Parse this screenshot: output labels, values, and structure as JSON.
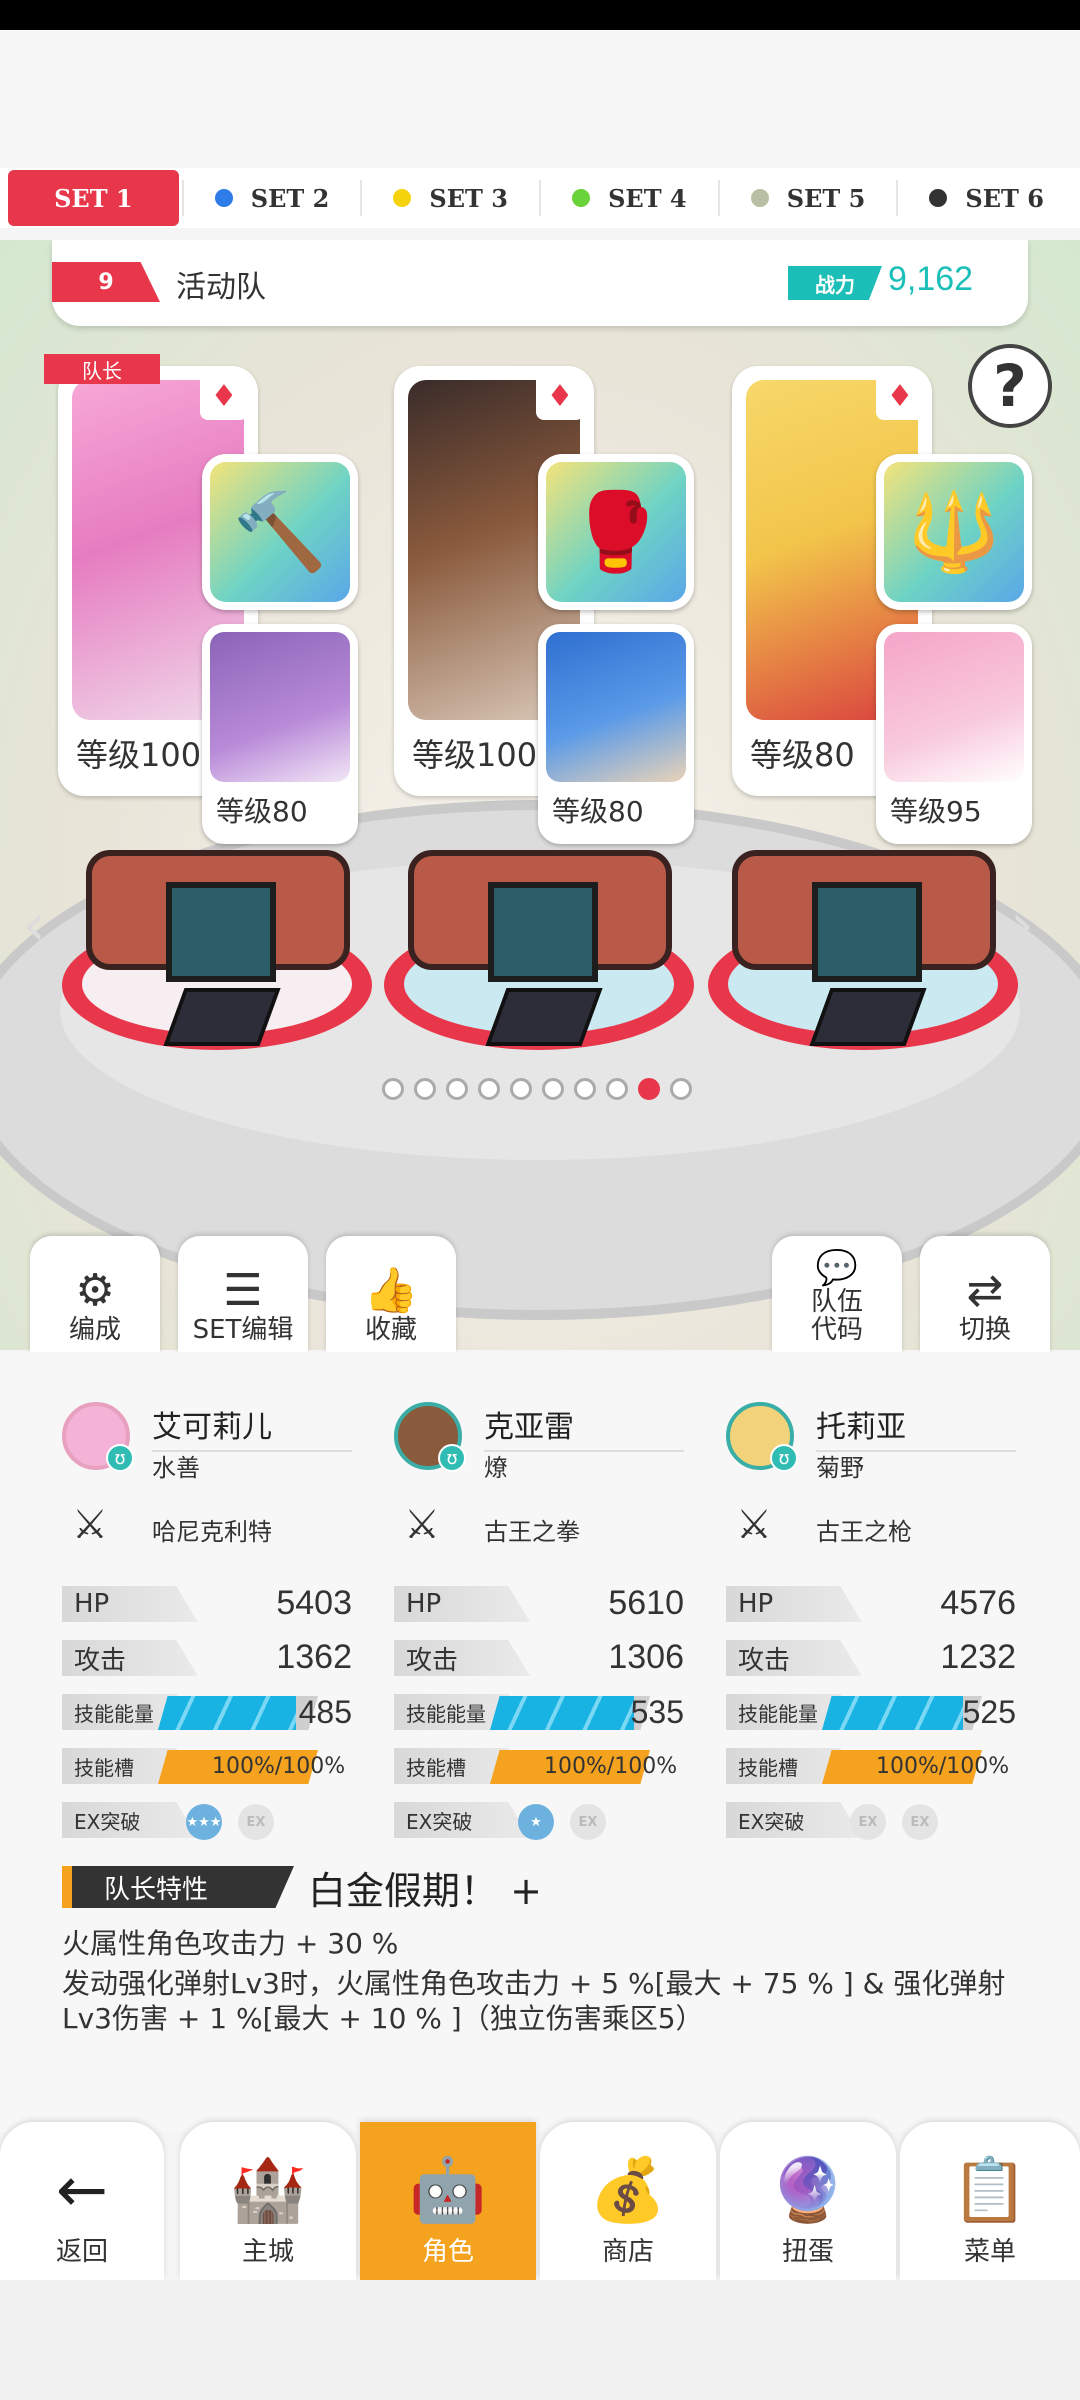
{
  "sets": [
    {
      "label": "SET 1",
      "color": "#e8374a",
      "active": true
    },
    {
      "label": "SET 2",
      "color": "#2f7be8"
    },
    {
      "label": "SET 3",
      "color": "#f5d30c"
    },
    {
      "label": "SET 4",
      "color": "#6bd33a"
    },
    {
      "label": "SET 5",
      "color": "#b7bfa5"
    },
    {
      "label": "SET 6",
      "color": "#333333"
    }
  ],
  "team": {
    "number": "9",
    "name": "活动队",
    "power_label": "战力",
    "power_value": "9,162"
  },
  "leader_tag": "队长",
  "help_icon": "?",
  "cards": [
    {
      "level": "等级100",
      "sub_level": "等级80"
    },
    {
      "level": "等级100",
      "sub_level": "等级80"
    },
    {
      "level": "等级80",
      "sub_level": "等级95"
    }
  ],
  "carousel": {
    "count": 10,
    "active_index": 8
  },
  "actions": {
    "formation": "编成",
    "set_edit": "SET编辑",
    "favorite": "收藏",
    "team_code": "队伍\n代码",
    "switch": "切换"
  },
  "characters": [
    {
      "name": "艾可莉儿",
      "attribute": "水善",
      "weapon": "哈尼克利特",
      "hp": "5403",
      "atk": "1362",
      "skill_energy": "485",
      "skill_slot": "100%/100%"
    },
    {
      "name": "克亚雷",
      "attribute": "燎",
      "weapon": "古王之拳",
      "hp": "5610",
      "atk": "1306",
      "skill_energy": "535",
      "skill_slot": "100%/100%"
    },
    {
      "name": "托莉亚",
      "attribute": "菊野",
      "weapon": "古王之枪",
      "hp": "4576",
      "atk": "1232",
      "skill_energy": "525",
      "skill_slot": "100%/100%"
    }
  ],
  "stat_labels": {
    "hp": "HP",
    "atk": "攻击",
    "energy": "技能能量",
    "slot": "技能槽",
    "ex": "EX突破"
  },
  "leader_trait": {
    "tag": "队长特性",
    "name": "白金假期！ +",
    "line1": "火属性角色攻击力 + 30 %",
    "line2": "发动强化弹射Lv3时，火属性角色攻击力 + 5 %[最大 + 75 % ] & 强化弹射Lv3伤害 + 1 %[最大 + 10 % ]（独立伤害乘区5）"
  },
  "nav": {
    "back": "返回",
    "city": "主城",
    "character": "角色",
    "shop": "商店",
    "gacha": "扭蛋",
    "menu": "菜单"
  }
}
